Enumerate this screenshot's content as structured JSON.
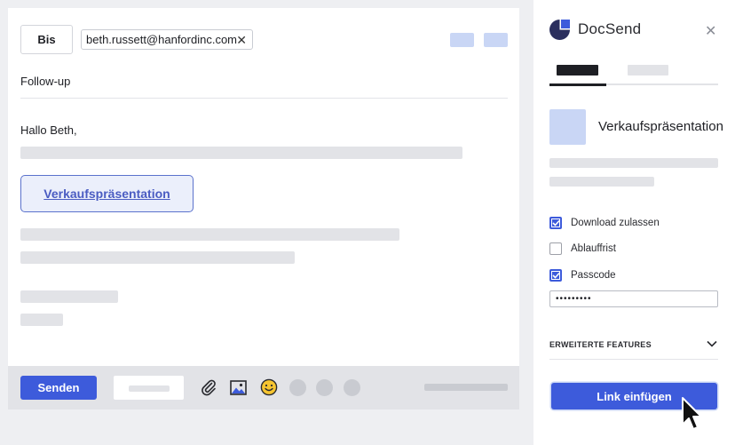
{
  "compose": {
    "to_label": "Bis",
    "recipient": "beth.russett@hanfordinc.com",
    "subject": "Follow-up",
    "greeting": "Hallo Beth,",
    "doc_link": "Verkaufspräsentation"
  },
  "toolbar": {
    "send_label": "Senden",
    "icons": [
      "paperclip-icon",
      "image-icon",
      "emoji-icon"
    ]
  },
  "panel": {
    "brand": "DocSend",
    "document_name": "Verkaufspräsentation",
    "options": [
      {
        "label": "Download zulassen",
        "checked": true
      },
      {
        "label": "Ablauffrist",
        "checked": false
      },
      {
        "label": "Passcode",
        "checked": true
      }
    ],
    "passcode_mask": "•••••••••",
    "advanced_label": "ERWEITERTE FEATURES",
    "insert_label": "Link einfügen"
  },
  "colors": {
    "accent": "#3d5bdb",
    "placeholder": "#e2e3e7",
    "light_accent": "#c9d6f5"
  }
}
